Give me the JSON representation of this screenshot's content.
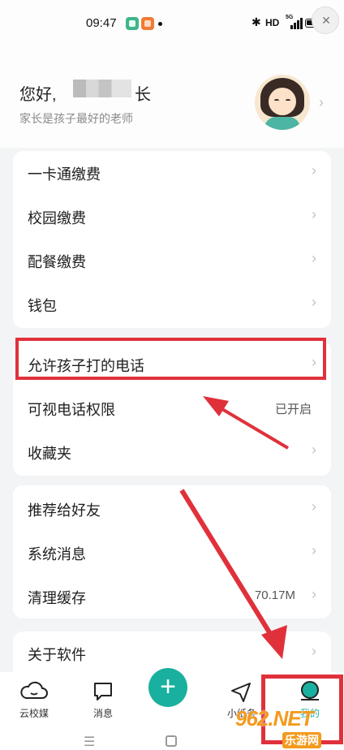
{
  "status_bar": {
    "time": "09:47",
    "network": "HD",
    "signal": "5G"
  },
  "profile": {
    "greeting": "您好,",
    "name_suffix": "长",
    "subtitle": "家长是孩子最好的老师"
  },
  "menu": {
    "group1": [
      {
        "label": "一卡通缴费"
      },
      {
        "label": "校园缴费"
      },
      {
        "label": "配餐缴费"
      },
      {
        "label": "钱包"
      }
    ],
    "group2": [
      {
        "label": "允许孩子打的电话"
      },
      {
        "label": "可视电话权限",
        "value": "已开启"
      },
      {
        "label": "收藏夹"
      }
    ],
    "group3": [
      {
        "label": "推荐给好友"
      },
      {
        "label": "系统消息"
      },
      {
        "label": "清理缓存",
        "value": "70.17M"
      }
    ],
    "group4": [
      {
        "label": "关于软件"
      }
    ]
  },
  "tabbar": {
    "tabs": [
      {
        "label": "云校媒",
        "icon": "cloud-icon"
      },
      {
        "label": "消息",
        "icon": "chat-icon"
      },
      {
        "label": "小纸条",
        "icon": "send-icon"
      },
      {
        "label": "我的",
        "icon": "profile-icon"
      }
    ],
    "fab_label": "+"
  },
  "watermark": {
    "brand": "962.NET",
    "sub": "乐游网"
  },
  "colors": {
    "accent": "#1ab0a0",
    "annotation": "#e0313b"
  }
}
